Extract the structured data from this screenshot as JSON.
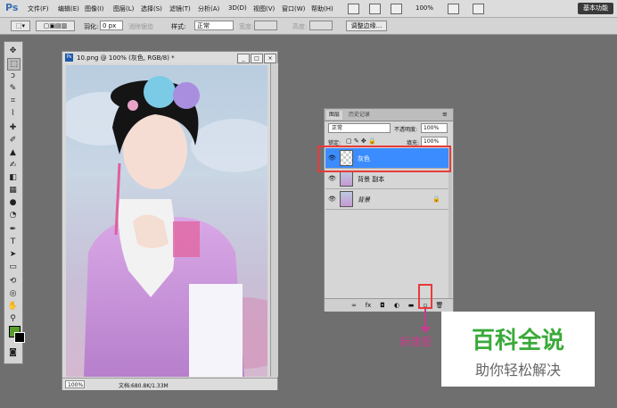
{
  "app": {
    "logo": "Ps",
    "workspace_button": "基本功能",
    "zoom": "100%"
  },
  "menu": [
    "文件(F)",
    "编辑(E)",
    "图像(I)",
    "图层(L)",
    "选择(S)",
    "滤镜(T)",
    "分析(A)",
    "3D(D)",
    "视图(V)",
    "窗口(W)",
    "帮助(H)"
  ],
  "options": {
    "feather_label": "羽化:",
    "feather_value": "0 px",
    "antialias_label": "消除锯齿",
    "style_label": "样式:",
    "style_value": "正常",
    "width_label": "宽度:",
    "height_label": "高度:",
    "refine_edge": "调整边缘..."
  },
  "document": {
    "title": "10.png @ 100% (灰色, RGB/8) *",
    "status_zoom": "100%",
    "status_file": "文档:680.8K/1.33M"
  },
  "layers_panel": {
    "tabs": [
      "图层",
      "历史记录"
    ],
    "blend_mode": "正常",
    "opacity_label": "不透明度:",
    "opacity_value": "100%",
    "lock_label": "锁定:",
    "fill_label": "填充:",
    "fill_value": "100%",
    "layers": [
      {
        "name": "灰色",
        "selected": true
      },
      {
        "name": "背景 副本",
        "selected": false
      },
      {
        "name": "背景",
        "selected": false,
        "locked": true
      }
    ]
  },
  "annotation": "新建图",
  "watermark": {
    "title": "百科全说",
    "subtitle": "助你轻松解决"
  },
  "colors": {
    "foreground": "#5a9c2c",
    "background": "#000000",
    "selection": "#3b8cff",
    "highlight": "#e83a3a"
  }
}
